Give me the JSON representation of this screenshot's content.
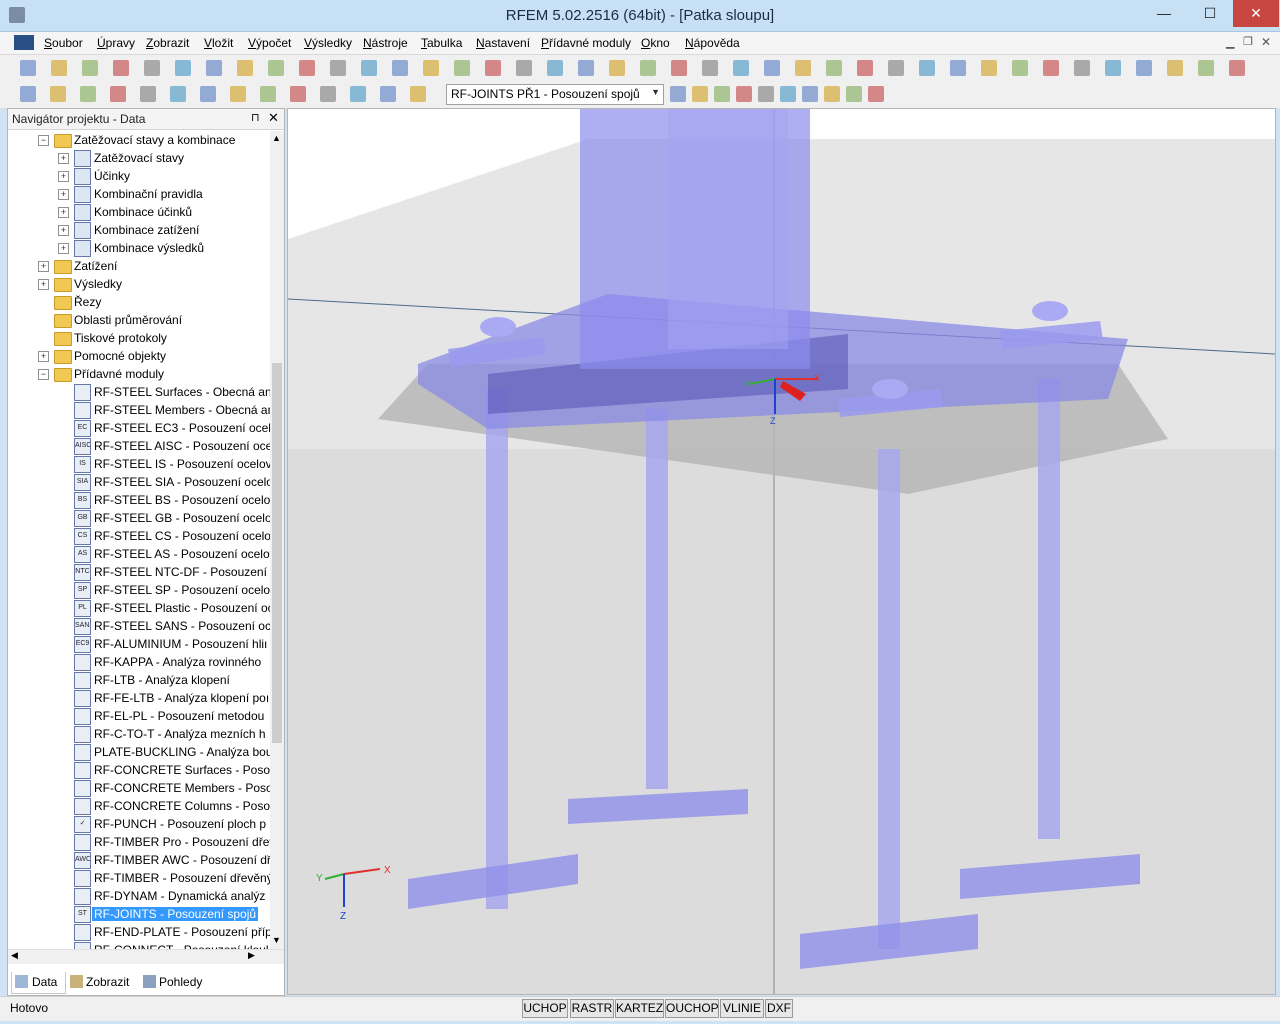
{
  "window": {
    "title": "RFEM 5.02.2516 (64bit) - [Patka sloupu]",
    "minimize": "—",
    "maximize": "☐",
    "close": "✕"
  },
  "menu": [
    "Soubor",
    "Úpravy",
    "Zobrazit",
    "Vložit",
    "Výpočet",
    "Výsledky",
    "Nástroje",
    "Tabulka",
    "Nastavení",
    "Přídavné moduly",
    "Okno",
    "Nápověda"
  ],
  "toolbar": {
    "combo_value": "RF-JOINTS PŘ1 - Posouzení spojů"
  },
  "navigator": {
    "title": "Navigátor projektu - Data",
    "pin": "⊓",
    "close": "✕",
    "items": [
      {
        "label": "Zatěžovací stavy a kombinace",
        "kind": "folder",
        "level": 1,
        "exp": "-"
      },
      {
        "label": "Zatěžovací stavy",
        "kind": "item",
        "level": 2,
        "exp": "+"
      },
      {
        "label": "Účinky",
        "kind": "item",
        "level": 2,
        "exp": "+"
      },
      {
        "label": "Kombinační pravidla",
        "kind": "item",
        "level": 2,
        "exp": "+"
      },
      {
        "label": "Kombinace účinků",
        "kind": "item",
        "level": 2,
        "exp": "+"
      },
      {
        "label": "Kombinace zatížení",
        "kind": "item",
        "level": 2,
        "exp": "+"
      },
      {
        "label": "Kombinace výsledků",
        "kind": "item",
        "level": 2,
        "exp": "+"
      },
      {
        "label": "Zatížení",
        "kind": "folder",
        "level": 1,
        "exp": "+"
      },
      {
        "label": "Výsledky",
        "kind": "folder",
        "level": 1,
        "exp": "+"
      },
      {
        "label": "Řezy",
        "kind": "folder",
        "level": 1,
        "exp": ""
      },
      {
        "label": "Oblasti průměrování",
        "kind": "folder",
        "level": 1,
        "exp": ""
      },
      {
        "label": "Tiskové protokoly",
        "kind": "folder",
        "level": 1,
        "exp": ""
      },
      {
        "label": "Pomocné objekty",
        "kind": "folder",
        "level": 1,
        "exp": "+"
      },
      {
        "label": "Přídavné moduly",
        "kind": "folder",
        "level": 1,
        "exp": "-"
      },
      {
        "label": "RF-STEEL Surfaces - Obecná ana",
        "kind": "module",
        "level": 2,
        "icon": ""
      },
      {
        "label": "RF-STEEL Members - Obecná an",
        "kind": "module",
        "level": 2,
        "icon": ""
      },
      {
        "label": "RF-STEEL EC3 - Posouzení ocelo",
        "kind": "module",
        "level": 2,
        "icon": "EC"
      },
      {
        "label": "RF-STEEL AISC - Posouzení ocel",
        "kind": "module",
        "level": 2,
        "icon": "AISC"
      },
      {
        "label": "RF-STEEL IS - Posouzení ocelový",
        "kind": "module",
        "level": 2,
        "icon": "IS"
      },
      {
        "label": "RF-STEEL SIA - Posouzení ocelo",
        "kind": "module",
        "level": 2,
        "icon": "SIA"
      },
      {
        "label": "RF-STEEL BS - Posouzení ocelov",
        "kind": "module",
        "level": 2,
        "icon": "BS"
      },
      {
        "label": "RF-STEEL GB - Posouzení ocelov",
        "kind": "module",
        "level": 2,
        "icon": "GB"
      },
      {
        "label": "RF-STEEL CS - Posouzení ocelov",
        "kind": "module",
        "level": 2,
        "icon": "CS"
      },
      {
        "label": "RF-STEEL AS - Posouzení ocelov",
        "kind": "module",
        "level": 2,
        "icon": "AS"
      },
      {
        "label": "RF-STEEL NTC-DF - Posouzení c",
        "kind": "module",
        "level": 2,
        "icon": "NTC"
      },
      {
        "label": "RF-STEEL SP - Posouzení ocelov",
        "kind": "module",
        "level": 2,
        "icon": "SP"
      },
      {
        "label": "RF-STEEL Plastic - Posouzení oc",
        "kind": "module",
        "level": 2,
        "icon": "PL"
      },
      {
        "label": "RF-STEEL SANS - Posouzení oce",
        "kind": "module",
        "level": 2,
        "icon": "SANS"
      },
      {
        "label": "RF-ALUMINIUM - Posouzení hliı",
        "kind": "module",
        "level": 2,
        "icon": "EC9"
      },
      {
        "label": "RF-KAPPA - Analýza rovinného",
        "kind": "module",
        "level": 2,
        "icon": ""
      },
      {
        "label": "RF-LTB - Analýza klopení",
        "kind": "module",
        "level": 2,
        "icon": ""
      },
      {
        "label": "RF-FE-LTB - Analýza klopení poı",
        "kind": "module",
        "level": 2,
        "icon": ""
      },
      {
        "label": "RF-EL-PL - Posouzení metodou",
        "kind": "module",
        "level": 2,
        "icon": ""
      },
      {
        "label": "RF-C-TO-T - Analýza mezních h",
        "kind": "module",
        "level": 2,
        "icon": ""
      },
      {
        "label": "PLATE-BUCKLING - Analýza bou",
        "kind": "module",
        "level": 2,
        "icon": ""
      },
      {
        "label": "RF-CONCRETE Surfaces - Posou",
        "kind": "module",
        "level": 2,
        "icon": ""
      },
      {
        "label": "RF-CONCRETE Members - Poso",
        "kind": "module",
        "level": 2,
        "icon": ""
      },
      {
        "label": "RF-CONCRETE Columns - Poso",
        "kind": "module",
        "level": 2,
        "icon": ""
      },
      {
        "label": "RF-PUNCH - Posouzení ploch p",
        "kind": "module",
        "level": 2,
        "icon": "✓"
      },
      {
        "label": "RF-TIMBER Pro - Posouzení dřev",
        "kind": "module",
        "level": 2,
        "icon": ""
      },
      {
        "label": "RF-TIMBER AWC - Posouzení dř",
        "kind": "module",
        "level": 2,
        "icon": "AWC"
      },
      {
        "label": "RF-TIMBER - Posouzení dřevěný",
        "kind": "module",
        "level": 2,
        "icon": ""
      },
      {
        "label": "RF-DYNAM - Dynamická analýz",
        "kind": "module",
        "level": 2,
        "icon": ""
      },
      {
        "label": "RF-JOINTS - Posouzení spojů",
        "kind": "module",
        "level": 2,
        "icon": "ST",
        "selected": true
      },
      {
        "label": "RF-END-PLATE - Posouzení příp",
        "kind": "module",
        "level": 2,
        "icon": ""
      },
      {
        "label": "RF-CONNECT - Posouzení klouł",
        "kind": "module",
        "level": 2,
        "icon": ""
      }
    ],
    "tabs": [
      "Data",
      "Zobrazit",
      "Pohledy"
    ]
  },
  "viewport": {
    "axis_labels": {
      "x": "X",
      "y": "Y",
      "z": "Z"
    },
    "colors": {
      "steel": "#8080f0",
      "concrete": "#d8d8d8",
      "axis_x": "#e03030",
      "axis_y": "#30b030",
      "axis_z": "#2040d0",
      "marker": "#e02020"
    }
  },
  "status": {
    "text": "Hotovo",
    "buttons": [
      "UCHOP",
      "RASTR",
      "KARTEZ",
      "OUCHOP",
      "VLINIE",
      "DXF"
    ]
  }
}
